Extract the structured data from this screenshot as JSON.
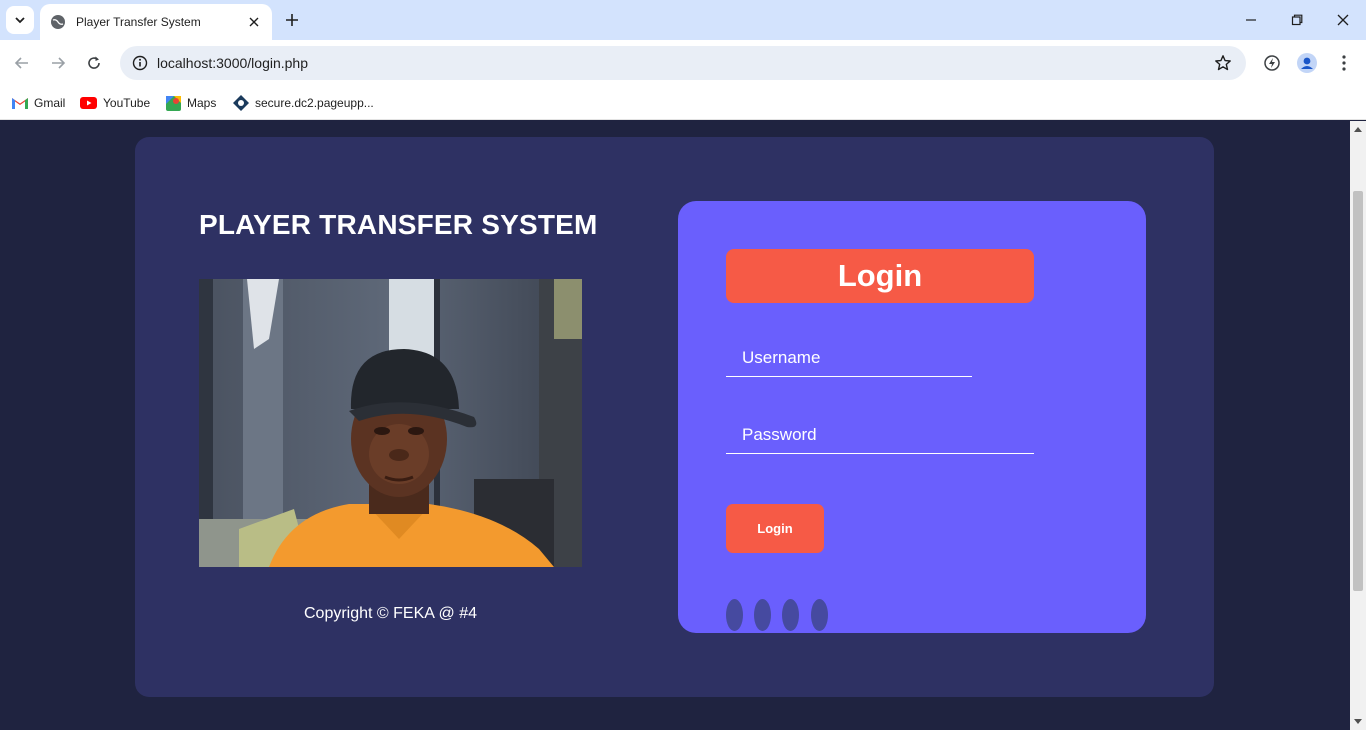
{
  "browser": {
    "tab_title": "Player Transfer System",
    "url": "localhost:3000/login.php",
    "bookmarks": [
      "Gmail",
      "YouTube",
      "Maps",
      "secure.dc2.pageupp..."
    ]
  },
  "page": {
    "site_title": "PLAYER TRANSFER SYSTEM",
    "copyright": "Copyright © FEKA @ #4",
    "login_heading": "Login",
    "username_placeholder": "Username",
    "password_placeholder": "Password",
    "login_button": "Login"
  },
  "colors": {
    "page_bg": "#1f2340",
    "card_bg": "#2e3163",
    "login_panel_bg": "#6a5ffd",
    "accent": "#f65a46"
  }
}
